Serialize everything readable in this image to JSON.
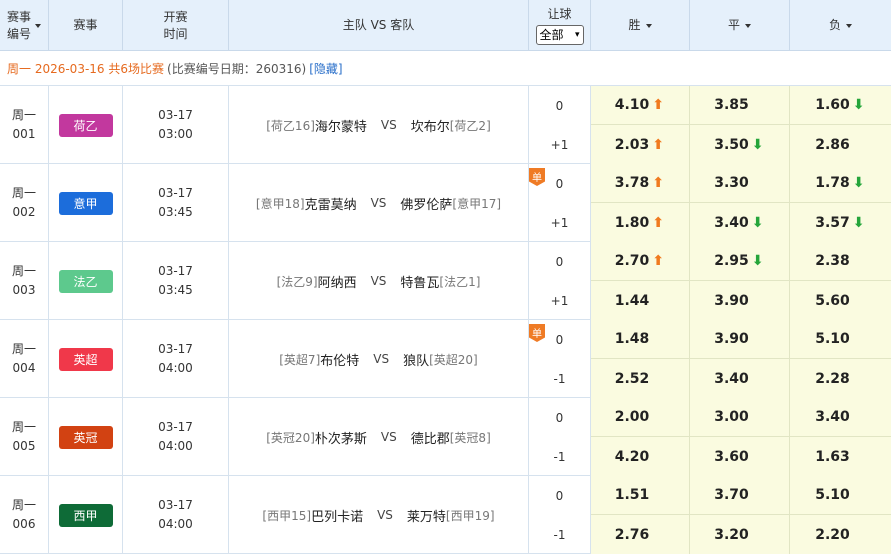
{
  "header": {
    "num_label_1": "赛事",
    "num_label_2": "编号",
    "league_label": "赛事",
    "time_label_1": "开赛",
    "time_label_2": "时间",
    "teams_label": "主队 VS 客队",
    "handicap_label": "让球",
    "handicap_select": "全部",
    "win_label": "胜",
    "draw_label": "平",
    "lose_label": "负"
  },
  "info": {
    "date_text": "周一 2026-03-16 共6场比赛",
    "meta_text": "(比赛编号日期：260316)",
    "hide_label": "[隐藏]"
  },
  "colors": {
    "up_arrow": "#f07a1f",
    "down_arrow": "#24a53a",
    "odds_bg": "#fafbe0",
    "header_bg": "#e5f0fb",
    "single_badge": "#ef7b25"
  },
  "matches": [
    {
      "day": "周一",
      "no": "001",
      "league": "荷乙",
      "league_color": "#c2389e",
      "date": "03-17",
      "time": "03:00",
      "home_rank": "[荷乙16]",
      "home": "海尔蒙特",
      "vs": "VS",
      "away": "坎布尔",
      "away_rank": "[荷乙2]",
      "single": "",
      "handicaps": [
        "0",
        "+1"
      ],
      "odds": [
        [
          {
            "v": "4.10",
            "t": "up"
          },
          {
            "v": "3.85",
            "t": ""
          },
          {
            "v": "1.60",
            "t": "down"
          }
        ],
        [
          {
            "v": "2.03",
            "t": "up"
          },
          {
            "v": "3.50",
            "t": "down"
          },
          {
            "v": "2.86",
            "t": ""
          }
        ]
      ]
    },
    {
      "day": "周一",
      "no": "002",
      "league": "意甲",
      "league_color": "#1c6ddb",
      "date": "03-17",
      "time": "03:45",
      "home_rank": "[意甲18]",
      "home": "克雷莫纳",
      "vs": "VS",
      "away": "佛罗伦萨",
      "away_rank": "[意甲17]",
      "single": "单",
      "handicaps": [
        "0",
        "+1"
      ],
      "odds": [
        [
          {
            "v": "3.78",
            "t": "up"
          },
          {
            "v": "3.30",
            "t": ""
          },
          {
            "v": "1.78",
            "t": "down"
          }
        ],
        [
          {
            "v": "1.80",
            "t": "up"
          },
          {
            "v": "3.40",
            "t": "down"
          },
          {
            "v": "3.57",
            "t": "down"
          }
        ]
      ]
    },
    {
      "day": "周一",
      "no": "003",
      "league": "法乙",
      "league_color": "#5dc98d",
      "date": "03-17",
      "time": "03:45",
      "home_rank": "[法乙9]",
      "home": "阿纳西",
      "vs": "VS",
      "away": "特鲁瓦",
      "away_rank": "[法乙1]",
      "single": "",
      "handicaps": [
        "0",
        "+1"
      ],
      "odds": [
        [
          {
            "v": "2.70",
            "t": "up"
          },
          {
            "v": "2.95",
            "t": "down"
          },
          {
            "v": "2.38",
            "t": ""
          }
        ],
        [
          {
            "v": "1.44",
            "t": ""
          },
          {
            "v": "3.90",
            "t": ""
          },
          {
            "v": "5.60",
            "t": ""
          }
        ]
      ]
    },
    {
      "day": "周一",
      "no": "004",
      "league": "英超",
      "league_color": "#f0384a",
      "date": "03-17",
      "time": "04:00",
      "home_rank": "[英超7]",
      "home": "布伦特",
      "vs": "VS",
      "away": "狼队",
      "away_rank": "[英超20]",
      "single": "单",
      "handicaps": [
        "0",
        "-1"
      ],
      "odds": [
        [
          {
            "v": "1.48",
            "t": ""
          },
          {
            "v": "3.90",
            "t": ""
          },
          {
            "v": "5.10",
            "t": ""
          }
        ],
        [
          {
            "v": "2.52",
            "t": ""
          },
          {
            "v": "3.40",
            "t": ""
          },
          {
            "v": "2.28",
            "t": ""
          }
        ]
      ]
    },
    {
      "day": "周一",
      "no": "005",
      "league": "英冠",
      "league_color": "#d24212",
      "date": "03-17",
      "time": "04:00",
      "home_rank": "[英冠20]",
      "home": "朴次茅斯",
      "vs": "VS",
      "away": "德比郡",
      "away_rank": "[英冠8]",
      "single": "",
      "handicaps": [
        "0",
        "-1"
      ],
      "odds": [
        [
          {
            "v": "2.00",
            "t": ""
          },
          {
            "v": "3.00",
            "t": ""
          },
          {
            "v": "3.40",
            "t": ""
          }
        ],
        [
          {
            "v": "4.20",
            "t": ""
          },
          {
            "v": "3.60",
            "t": ""
          },
          {
            "v": "1.63",
            "t": ""
          }
        ]
      ]
    },
    {
      "day": "周一",
      "no": "006",
      "league": "西甲",
      "league_color": "#0e6b37",
      "date": "03-17",
      "time": "04:00",
      "home_rank": "[西甲15]",
      "home": "巴列卡诺",
      "vs": "VS",
      "away": "莱万特",
      "away_rank": "[西甲19]",
      "single": "",
      "handicaps": [
        "0",
        "-1"
      ],
      "odds": [
        [
          {
            "v": "1.51",
            "t": ""
          },
          {
            "v": "3.70",
            "t": ""
          },
          {
            "v": "5.10",
            "t": ""
          }
        ],
        [
          {
            "v": "2.76",
            "t": ""
          },
          {
            "v": "3.20",
            "t": ""
          },
          {
            "v": "2.20",
            "t": ""
          }
        ]
      ]
    }
  ]
}
